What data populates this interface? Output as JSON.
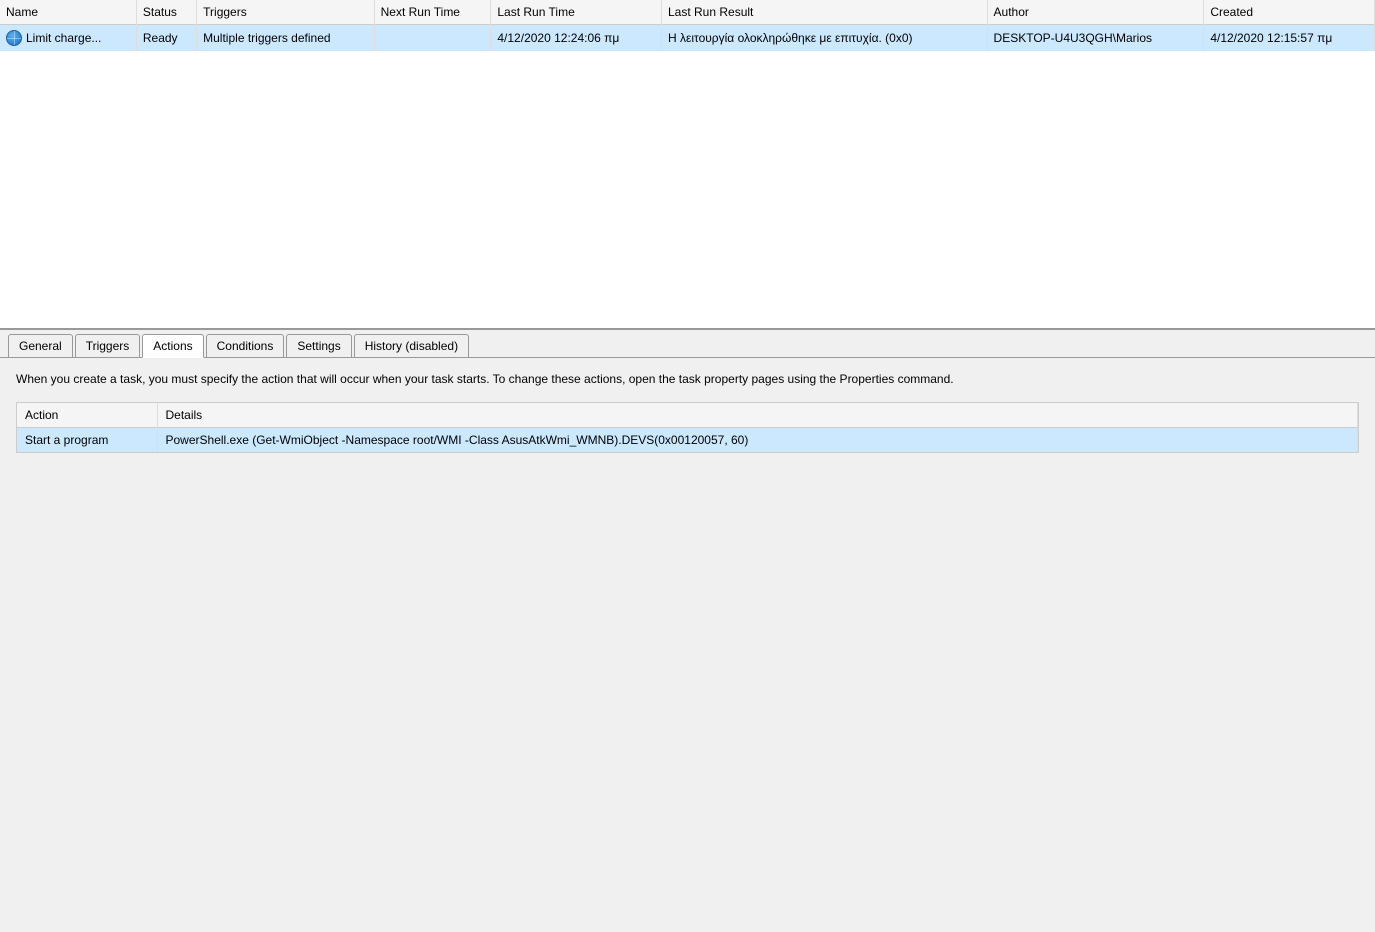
{
  "taskList": {
    "columns": [
      {
        "key": "name",
        "label": "Name"
      },
      {
        "key": "status",
        "label": "Status"
      },
      {
        "key": "triggers",
        "label": "Triggers"
      },
      {
        "key": "nextRunTime",
        "label": "Next Run Time"
      },
      {
        "key": "lastRunTime",
        "label": "Last Run Time"
      },
      {
        "key": "lastRunResult",
        "label": "Last Run Result"
      },
      {
        "key": "author",
        "label": "Author"
      },
      {
        "key": "created",
        "label": "Created"
      }
    ],
    "rows": [
      {
        "name": "Limit charge...",
        "status": "Ready",
        "triggers": "Multiple triggers defined",
        "nextRunTime": "",
        "lastRunTime": "4/12/2020 12:24:06 πμ",
        "lastRunResult": "Η λειτουργία ολοκληρώθηκε με επιτυχία. (0x0)",
        "author": "DESKTOP-U4U3QGH\\Marios",
        "created": "4/12/2020 12:15:57 πμ"
      }
    ]
  },
  "tabs": [
    {
      "id": "general",
      "label": "General",
      "active": false
    },
    {
      "id": "triggers",
      "label": "Triggers",
      "active": false
    },
    {
      "id": "actions",
      "label": "Actions",
      "active": true
    },
    {
      "id": "conditions",
      "label": "Conditions",
      "active": false
    },
    {
      "id": "settings",
      "label": "Settings",
      "active": false
    },
    {
      "id": "history",
      "label": "History (disabled)",
      "active": false
    }
  ],
  "actionsTab": {
    "description": "When you create a task, you must specify the action that will occur when your task starts.  To change these actions, open the task property pages using the Properties command.",
    "columns": [
      {
        "label": "Action"
      },
      {
        "label": "Details"
      }
    ],
    "rows": [
      {
        "action": "Start a program",
        "details": "PowerShell.exe (Get-WmiObject -Namespace root/WMI -Class AsusAtkWmi_WMNB).DEVS(0x00120057, 60)"
      }
    ]
  }
}
